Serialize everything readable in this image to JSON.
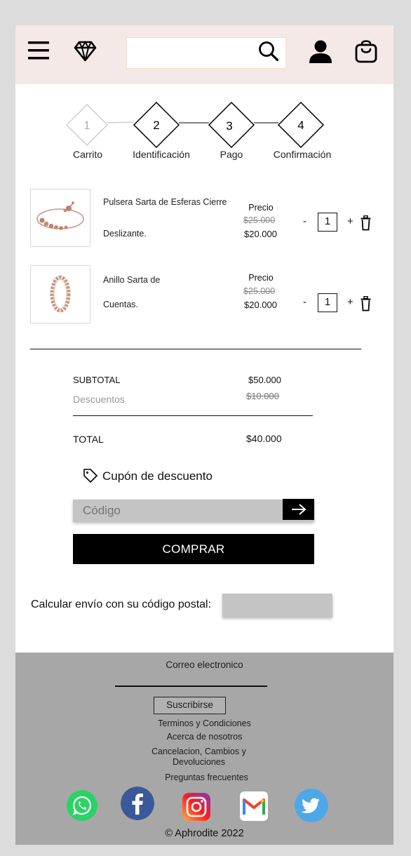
{
  "header": {
    "search_placeholder": ""
  },
  "steps": [
    {
      "number": "1",
      "label": "Carrito"
    },
    {
      "number": "2",
      "label": "Identificación"
    },
    {
      "number": "3",
      "label": "Pago"
    },
    {
      "number": "4",
      "label": "Confirmación"
    }
  ],
  "cart": {
    "items": [
      {
        "name_line1": "Pulsera Sarta de Esferas Cierre",
        "name_line2": "Deslizante.",
        "price_label": "Precio",
        "old_price": "$25.000",
        "price": "$20.000",
        "qty": "1",
        "minus": "-",
        "plus": "+"
      },
      {
        "name_line1": "Anillo Sarta de",
        "name_line2": "Cuentas.",
        "price_label": "Precio",
        "old_price": "$25.000",
        "price": "$20.000",
        "qty": "1",
        "minus": "-",
        "plus": "+"
      }
    ]
  },
  "totals": {
    "subtotal_label": "SUBTOTAL",
    "subtotal_value": "$50.000",
    "discount_label": "Descuentos",
    "discount_value": "$10.000",
    "total_label": "TOTAL",
    "total_value": "$40.000"
  },
  "coupon": {
    "title": "Cupón de descuento",
    "placeholder": "Código"
  },
  "buy_label": "COMPRAR",
  "shipping": {
    "label": "Calcular envío con su código postal:"
  },
  "footer": {
    "email_label": "Correo electronico",
    "subscribe": "Suscribirse",
    "links": {
      "terms": "Terminos y Condiciones",
      "about": "Acerca de nosotros",
      "returns_line1": "Cancelacion, Cambios y",
      "returns_line2": "Devoluciones",
      "faq": "Preguntas frecuentes"
    },
    "copyright": "Aphrodite 2022"
  },
  "colors": {
    "header_bg": "#f5e9e7",
    "footer_bg": "#a8a7a7",
    "whatsapp": "#2bd366",
    "facebook": "#3b5998",
    "twitter": "#4ea8e8"
  }
}
